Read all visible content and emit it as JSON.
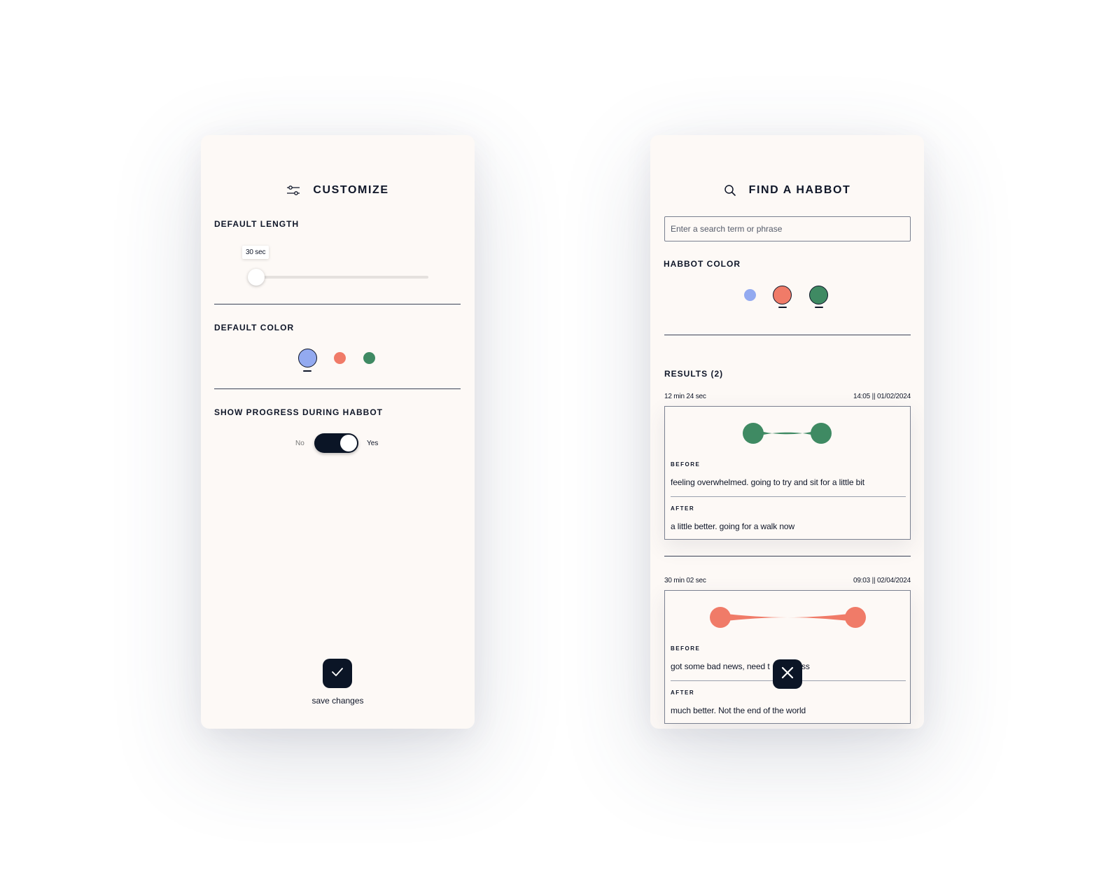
{
  "customize": {
    "title": "CUSTOMIZE",
    "title_icon": "sliders-icon",
    "default_length": {
      "label": "DEFAULT LENGTH",
      "value_label": "30 sec",
      "slider_fraction": 0.0
    },
    "default_color": {
      "label": "DEFAULT COLOR",
      "options": [
        {
          "name": "blue",
          "color": "#93aaf0",
          "selected": true
        },
        {
          "name": "coral",
          "color": "#f07b68",
          "selected": false
        },
        {
          "name": "green",
          "color": "#3f8a63",
          "selected": false
        }
      ]
    },
    "show_progress": {
      "label": "SHOW PROGRESS DURING HABBOT",
      "off_label": "No",
      "on_label": "Yes",
      "enabled": true
    },
    "save": {
      "icon": "check-icon",
      "label": "save changes"
    }
  },
  "find": {
    "title": "FIND A HABBOT",
    "title_icon": "search-icon",
    "search": {
      "placeholder": "Enter a search term or phrase",
      "value": ""
    },
    "habbot_color": {
      "label": "HABBOT COLOR",
      "options": [
        {
          "name": "blue",
          "color": "#93aaf0",
          "selected": false
        },
        {
          "name": "coral",
          "color": "#f07b68",
          "selected": true
        },
        {
          "name": "green",
          "color": "#3f8a63",
          "selected": true
        }
      ]
    },
    "results_label": "RESULTS (2)",
    "results": [
      {
        "duration": "12 min 24 sec",
        "timestamp": "14:05 || 01/02/2024",
        "color": "#3f8a63",
        "before_label": "BEFORE",
        "before_text": "feeling overwhelmed. going to try and sit for a little bit",
        "after_label": "AFTER",
        "after_text": "a little better. going for a walk now"
      },
      {
        "duration": "30 min 02 sec",
        "timestamp": "09:03 || 02/04/2024",
        "color": "#f07b68",
        "before_label": "BEFORE",
        "before_text": "got some bad news, need t",
        "before_text_tail": "ss",
        "after_label": "AFTER",
        "after_text": "much better. Not the end of the world"
      }
    ],
    "close_icon": "close-icon"
  }
}
